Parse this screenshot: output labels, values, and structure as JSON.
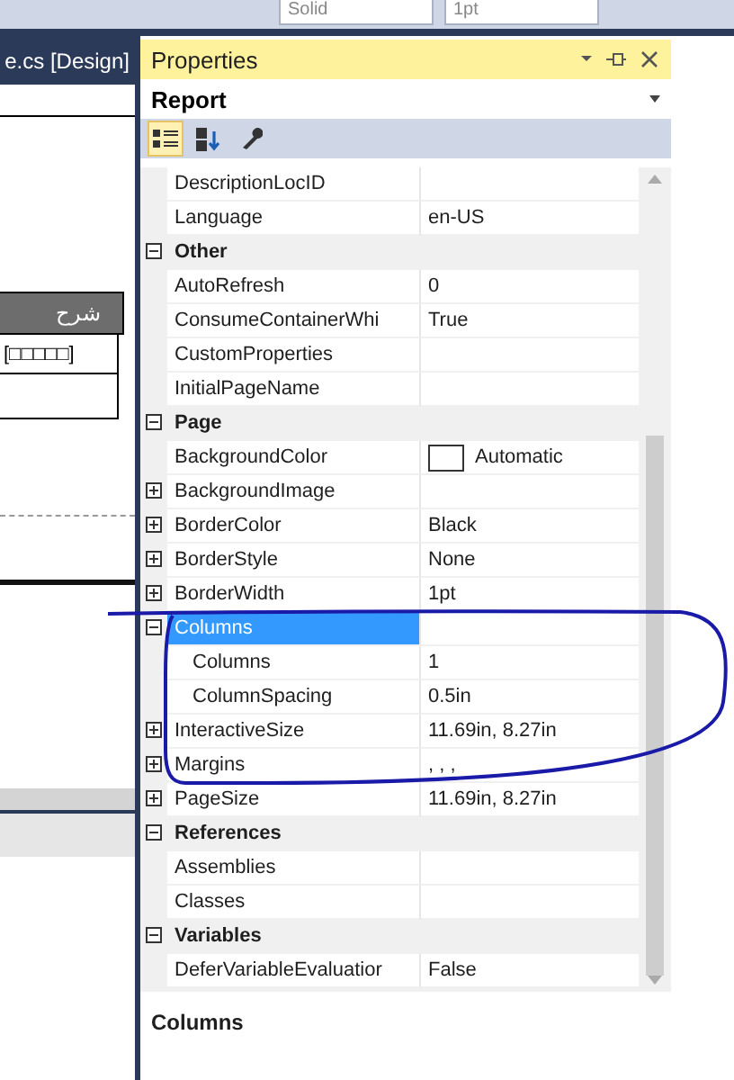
{
  "toolbar": {
    "dropdowns": [
      {
        "value": "Solid"
      },
      {
        "value": "1pt"
      }
    ]
  },
  "designer": {
    "tab": "e.cs [Design]",
    "table": {
      "header": "شرح",
      "cell": "[□□□□□]"
    }
  },
  "properties": {
    "title": "Properties",
    "object": "Report",
    "view_buttons": [
      {
        "kind": "categorized",
        "selected": true
      },
      {
        "kind": "alphabetical",
        "selected": false
      },
      {
        "kind": "property-pages",
        "selected": false
      }
    ],
    "rows": [
      {
        "kind": "property",
        "name": "DescriptionLocID",
        "value": ""
      },
      {
        "kind": "property",
        "name": "Language",
        "value": "en-US"
      },
      {
        "kind": "category",
        "name": "Other",
        "expanded": true
      },
      {
        "kind": "property",
        "name": "AutoRefresh",
        "value": "0"
      },
      {
        "kind": "property",
        "name": "ConsumeContainerWhi",
        "value": "True"
      },
      {
        "kind": "property",
        "name": "CustomProperties",
        "value": ""
      },
      {
        "kind": "property",
        "name": "InitialPageName",
        "value": ""
      },
      {
        "kind": "category",
        "name": "Page",
        "expanded": true
      },
      {
        "kind": "color-property",
        "name": "BackgroundColor",
        "value": "Automatic"
      },
      {
        "kind": "property",
        "name": "BackgroundImage",
        "value": "",
        "expanded": false
      },
      {
        "kind": "property",
        "name": "BorderColor",
        "value": "Black",
        "expanded": false
      },
      {
        "kind": "property",
        "name": "BorderStyle",
        "value": "None",
        "expanded": false
      },
      {
        "kind": "property",
        "name": "BorderWidth",
        "value": "1pt",
        "expanded": false
      },
      {
        "kind": "property",
        "name": "Columns",
        "value": "",
        "expanded": true,
        "selected": true,
        "children": [
          {
            "kind": "property",
            "name": "Columns",
            "value": "1"
          },
          {
            "kind": "property",
            "name": "ColumnSpacing",
            "value": "0.5in"
          }
        ]
      },
      {
        "kind": "property",
        "name": "InteractiveSize",
        "value": "11.69in, 8.27in",
        "expanded": false
      },
      {
        "kind": "property",
        "name": "Margins",
        "value": ", , ,",
        "expanded": false
      },
      {
        "kind": "property",
        "name": "PageSize",
        "value": "11.69in, 8.27in",
        "expanded": false
      },
      {
        "kind": "category",
        "name": "References",
        "expanded": true
      },
      {
        "kind": "property",
        "name": "Assemblies",
        "value": ""
      },
      {
        "kind": "property",
        "name": "Classes",
        "value": ""
      },
      {
        "kind": "category",
        "name": "Variables",
        "expanded": true
      },
      {
        "kind": "property",
        "name": "DeferVariableEvaluatior",
        "value": "False"
      }
    ],
    "description": {
      "title": "Columns"
    }
  }
}
